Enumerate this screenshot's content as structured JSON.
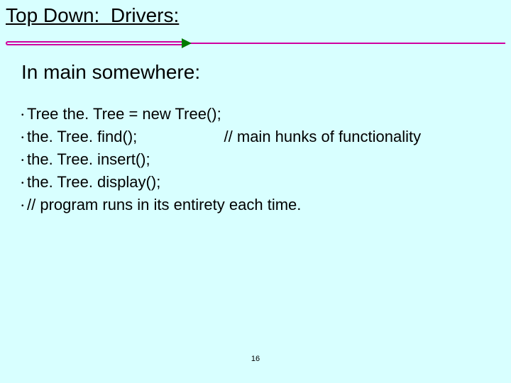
{
  "title": "Top Down:  Drivers:",
  "subhead": "In main somewhere:",
  "bullets": {
    "b0": "Tree the. Tree = new Tree();",
    "b1": "the. Tree. find();                    // main hunks of functionality",
    "b2": "the. Tree. insert();",
    "b3": "the. Tree. display();",
    "b4": "// program runs in its entirety each time."
  },
  "page_number": "16"
}
